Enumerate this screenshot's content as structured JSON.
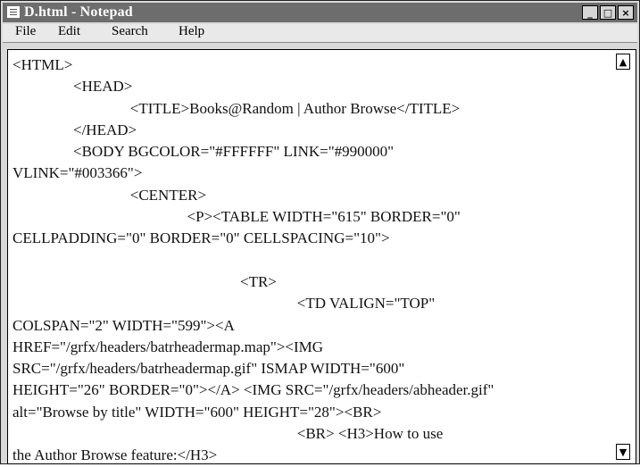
{
  "window": {
    "title": "D.html - Notepad",
    "buttons": {
      "minimize": "_",
      "maximize": "□",
      "close": "×"
    }
  },
  "menu": {
    "file": "File",
    "edit": "Edit",
    "search": "Search",
    "help": "Help"
  },
  "editor": {
    "lines": [
      "<HTML>",
      "                <HEAD>",
      "                               <TITLE>Books@Random | Author Browse</TITLE>",
      "                </HEAD>",
      "                <BODY BGCOLOR=\"#FFFFFF\" LINK=\"#990000\"",
      "VLINK=\"#003366\">",
      "                               <CENTER>",
      "                                              <P><TABLE WIDTH=\"615\" BORDER=\"0\"",
      "CELLPADDING=\"0\" BORDER=\"0\" CELLSPACING=\"10\">",
      "",
      "                                                            <TR>",
      "                                                                           <TD VALIGN=\"TOP\"",
      "COLSPAN=\"2\" WIDTH=\"599\"><A",
      "HREF=\"/grfx/headers/batrheadermap.map\"><IMG",
      "SRC=\"/grfx/headers/batrheadermap.gif\" ISMAP WIDTH=\"600\"",
      "HEIGHT=\"26\" BORDER=\"0\"></A> <IMG SRC=\"/grfx/headers/abheader.gif\"",
      "alt=\"Browse by title\" WIDTH=\"600\" HEIGHT=\"28\"><BR>",
      "                                                                           <BR> <H3>How to use",
      "the Author Browse feature:</H3>"
    ]
  }
}
